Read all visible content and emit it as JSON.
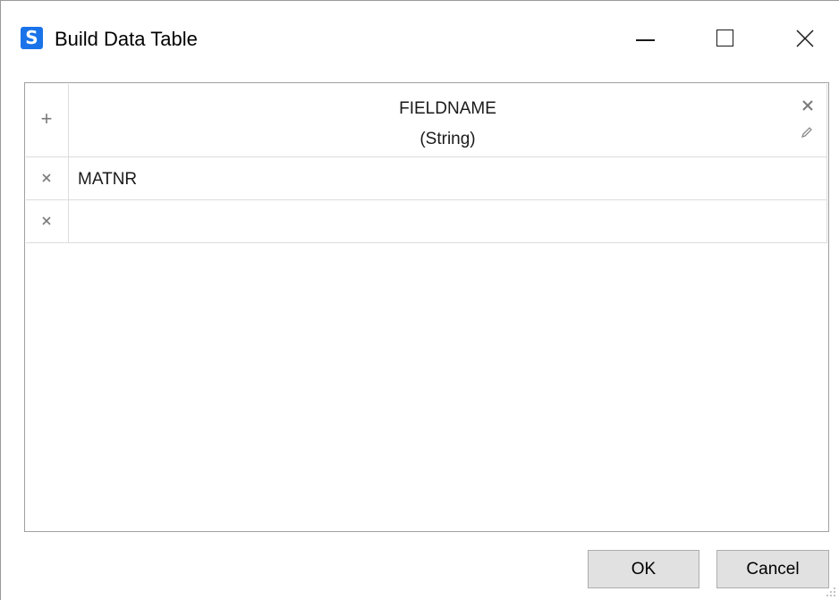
{
  "window": {
    "title": "Build Data Table",
    "app_icon": "s-logo-icon",
    "controls": [
      "minimize-icon",
      "maximize-icon",
      "close-icon"
    ]
  },
  "table": {
    "columns": [
      {
        "name": "FIELDNAME",
        "type": "(String)"
      }
    ],
    "rows": [
      {
        "FIELDNAME": "MATNR"
      },
      {
        "FIELDNAME": ""
      }
    ]
  },
  "buttons": {
    "ok_label": "OK",
    "cancel_label": "Cancel"
  },
  "colors": {
    "accent": "#1a73e8",
    "button_bg": "#e1e1e1",
    "grid_line": "#dcdcdc"
  }
}
